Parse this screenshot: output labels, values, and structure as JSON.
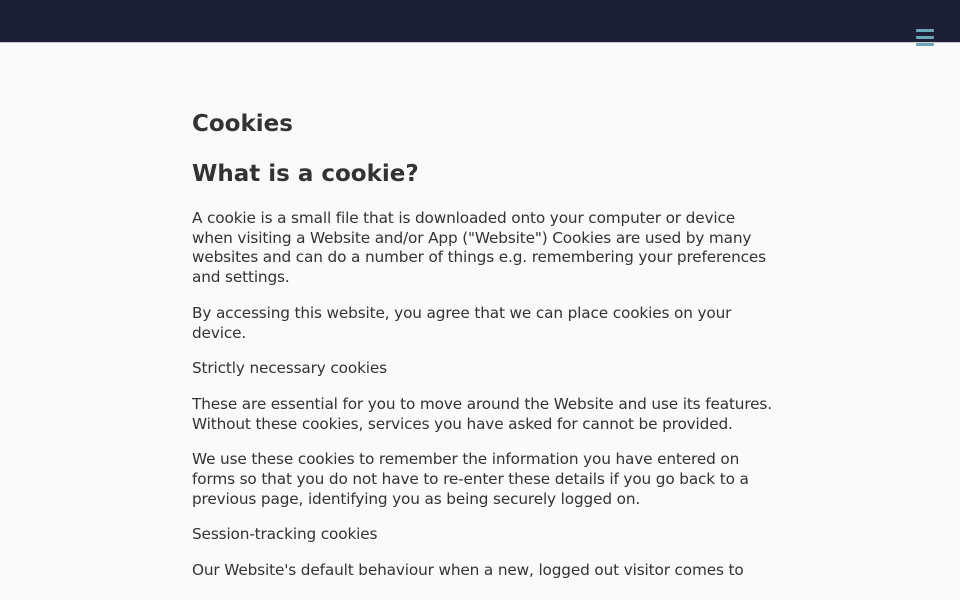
{
  "header": {
    "menu_icon": "hamburger-menu-icon",
    "background_color": "#1c1f35",
    "menu_icon_color": "#6aa6b8"
  },
  "main": {
    "title": "Cookies",
    "heading": "What is a cookie?",
    "paragraphs": [
      "A cookie is a small file that is downloaded onto your computer or device when visiting a Website and/or App (\"Website\") Cookies are used by many websites and can do a number of things e.g. remembering your preferences and settings.",
      "By accessing this website, you agree that we can place cookies on your device.",
      "Strictly necessary cookies",
      "These are essential for you to move around the Website and use its features. Without these cookies, services you have asked for cannot be provided.",
      "We use these cookies to remember the information you have entered on forms so that you do not have to re-enter these details if you go back to a previous page, identifying you as being securely logged on.",
      "Session-tracking cookies",
      "Our Website's default behaviour when a new, logged out visitor comes to"
    ]
  }
}
